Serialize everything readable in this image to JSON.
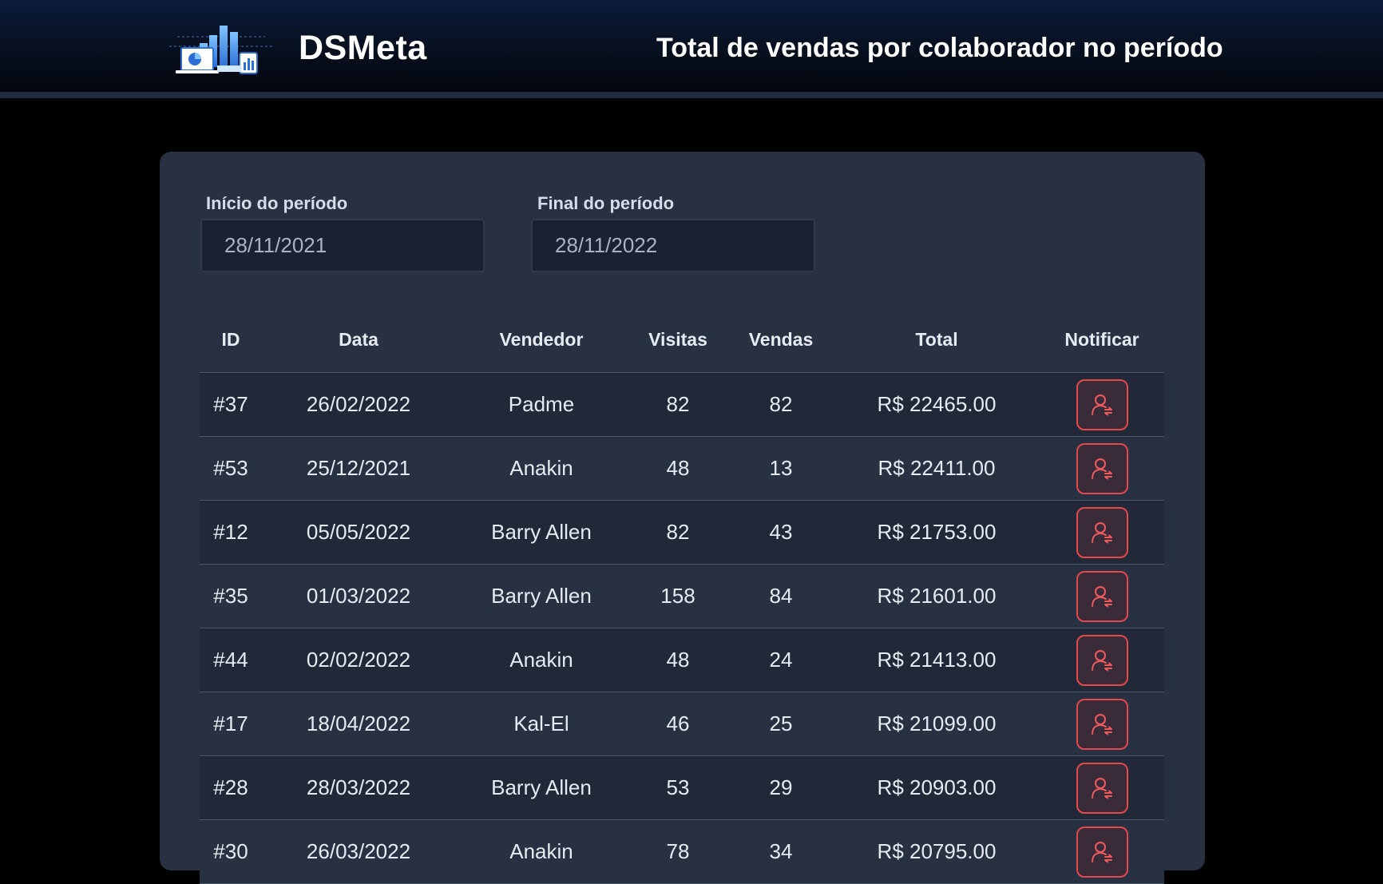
{
  "app": {
    "brand": "DSMeta",
    "header_title": "Total de vendas por colaborador no período"
  },
  "filters": {
    "start_label": "Início do período",
    "start_value": "28/11/2021",
    "end_label": "Final do período",
    "end_value": "28/11/2022"
  },
  "table": {
    "columns": [
      "ID",
      "Data",
      "Vendedor",
      "Visitas",
      "Vendas",
      "Total",
      "Notificar"
    ],
    "rows": [
      {
        "id": "#37",
        "date": "26/02/2022",
        "seller": "Padme",
        "visits": "82",
        "sales": "82",
        "total": "R$ 22465.00"
      },
      {
        "id": "#53",
        "date": "25/12/2021",
        "seller": "Anakin",
        "visits": "48",
        "sales": "13",
        "total": "R$ 22411.00"
      },
      {
        "id": "#12",
        "date": "05/05/2022",
        "seller": "Barry Allen",
        "visits": "82",
        "sales": "43",
        "total": "R$ 21753.00"
      },
      {
        "id": "#35",
        "date": "01/03/2022",
        "seller": "Barry Allen",
        "visits": "158",
        "sales": "84",
        "total": "R$ 21601.00"
      },
      {
        "id": "#44",
        "date": "02/02/2022",
        "seller": "Anakin",
        "visits": "48",
        "sales": "24",
        "total": "R$ 21413.00"
      },
      {
        "id": "#17",
        "date": "18/04/2022",
        "seller": "Kal-El",
        "visits": "46",
        "sales": "25",
        "total": "R$ 21099.00"
      },
      {
        "id": "#28",
        "date": "28/03/2022",
        "seller": "Barry Allen",
        "visits": "53",
        "sales": "29",
        "total": "R$ 20903.00"
      },
      {
        "id": "#30",
        "date": "26/03/2022",
        "seller": "Anakin",
        "visits": "78",
        "sales": "34",
        "total": "R$ 20795.00"
      }
    ]
  },
  "colors": {
    "accent": "#e5484d",
    "card_bg": "#283142",
    "row_alt_bg": "#212938",
    "header_bg": "#0d1b3a"
  },
  "icons": {
    "logo": "sales-dashboard-logo-icon",
    "notify": "user-notify-icon"
  }
}
